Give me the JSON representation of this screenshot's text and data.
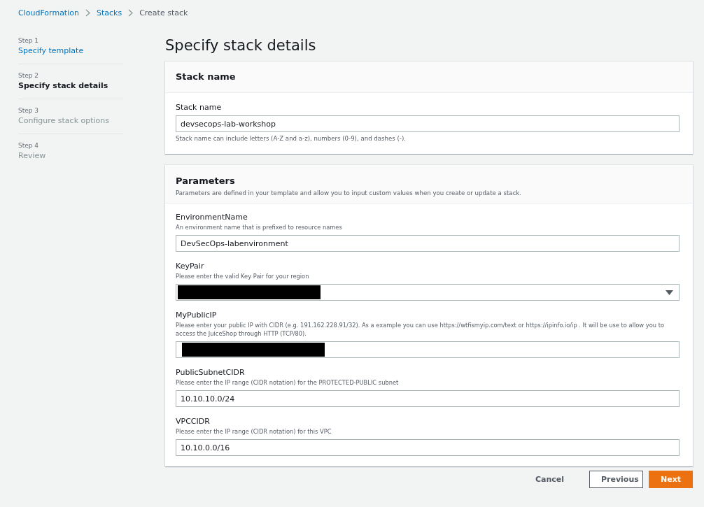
{
  "breadcrumb": [
    {
      "label": "CloudFormation",
      "kind": "link"
    },
    {
      "label": "Stacks",
      "kind": "link"
    },
    {
      "label": "Create stack",
      "kind": "current"
    }
  ],
  "steps": [
    {
      "step": "Step 1",
      "title": "Specify template",
      "kind": "completed"
    },
    {
      "step": "Step 2",
      "title": "Specify stack details",
      "kind": "current"
    },
    {
      "step": "Step 3",
      "title": "Configure stack options",
      "kind": "upcoming"
    },
    {
      "step": "Step 4",
      "title": "Review",
      "kind": "upcoming"
    }
  ],
  "page_title": "Specify stack details",
  "stack_name_card": {
    "heading": "Stack name",
    "label": "Stack name",
    "value": "devsecops-lab-workshop",
    "hint": "Stack name can include letters (A-Z and a-z), numbers (0-9), and dashes (-)."
  },
  "parameters_card": {
    "heading": "Parameters",
    "description": "Parameters are defined in your template and allow you to input custom values when you create or update a stack.",
    "parameters": [
      {
        "name": "EnvironmentName",
        "description": "An environment name that is prefixed to resource names",
        "kind": "text",
        "value": "DevSecOps-labenvironment"
      },
      {
        "name": "KeyPair",
        "description": "Please enter the valid Key Pair for your region",
        "kind": "select",
        "redacted": true
      },
      {
        "name": "MyPublicIP",
        "description": "Please enter your public IP with CIDR (e.g. 191.162.228.91/32). As a example you can use https://wtfismyip.com/text or https://ipinfo.io/ip . It will be use to allow you to access the JuiceShop through HTTP (TCP/80).",
        "kind": "text",
        "redacted": true
      },
      {
        "name": "PublicSubnetCIDR",
        "description": "Please enter the IP range (CIDR notation) for the PROTECTED-PUBLIC subnet",
        "kind": "text",
        "value": "10.10.10.0/24"
      },
      {
        "name": "VPCCIDR",
        "description": "Please enter the IP range (CIDR notation) for this VPC",
        "kind": "text",
        "value": "10.10.0.0/16"
      }
    ]
  },
  "buttons": [
    {
      "label": "Cancel",
      "kind": "link"
    },
    {
      "label": "Previous",
      "kind": "secondary"
    },
    {
      "label": "Next",
      "kind": "primary"
    }
  ]
}
